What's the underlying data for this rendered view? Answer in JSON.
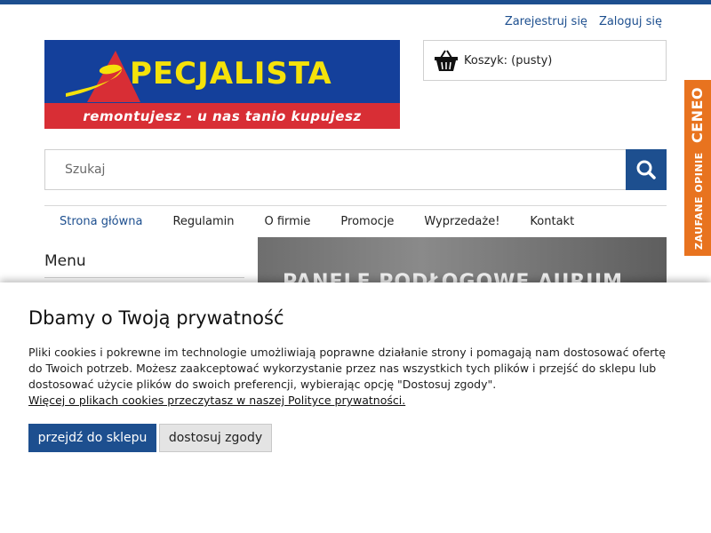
{
  "header": {
    "register_label": "Zarejestruj się",
    "login_label": "Zaloguj się"
  },
  "logo": {
    "brand": "PECJALISTA",
    "tagline": "remontujesz - u nas tanio kupujesz"
  },
  "cart": {
    "label": "Koszyk: (pusty)",
    "icon": "basket-icon"
  },
  "search": {
    "placeholder": "Szukaj",
    "icon": "search-icon"
  },
  "nav": {
    "items": [
      {
        "label": "Strona główna"
      },
      {
        "label": "Regulamin"
      },
      {
        "label": "O firmie"
      },
      {
        "label": "Promocje"
      },
      {
        "label": "Wyprzedaże!"
      },
      {
        "label": "Kontakt"
      }
    ]
  },
  "sidebar": {
    "title": "Menu"
  },
  "banner": {
    "text": "PANELE PODŁOGOWE AURUM"
  },
  "ceneo": {
    "label": "ZAUFANE OPINIE",
    "brand": "CENEO"
  },
  "cookie": {
    "title": "Dbamy o Twoją prywatność",
    "body": "Pliki cookies i pokrewne im technologie umożliwiają poprawne działanie strony i pomagają nam dostosować ofertę do Twoich potrzeb. Możesz zaakceptować wykorzystanie przez nas wszystkich tych plików i przejść do sklepu lub dostosować użycie plików do swoich preferencji, wybierając opcję \"Dostosuj zgody\".",
    "link": "Więcej o plikach cookies przeczytasz w naszej Polityce prywatności.",
    "accept_label": "przejdź do sklepu",
    "customize_label": "dostosuj zgody"
  },
  "colors": {
    "primary": "#1d4f8f",
    "logo_blue": "#14409b",
    "logo_red": "#d82e35",
    "logo_yellow": "#f5e20a",
    "ceneo_orange": "#e8731f"
  }
}
